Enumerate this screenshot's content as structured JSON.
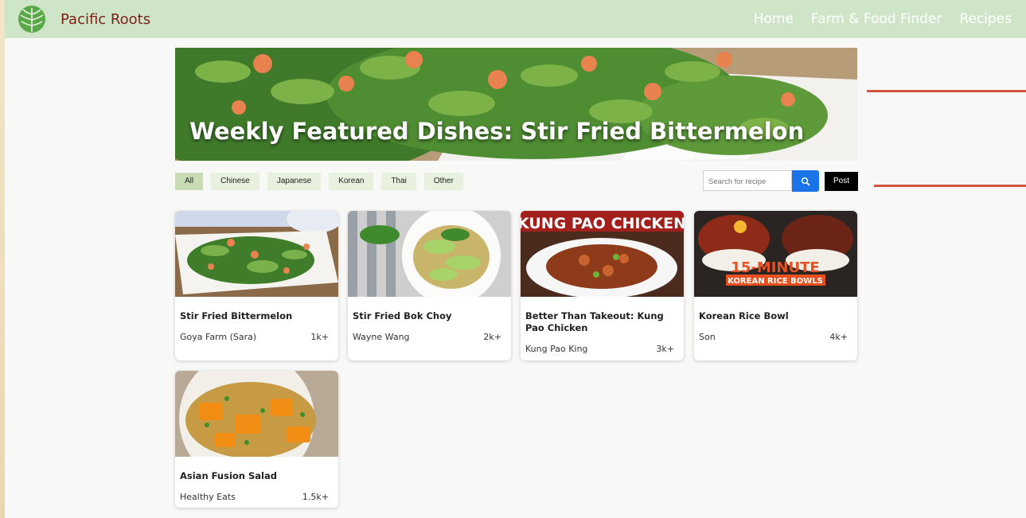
{
  "header": {
    "brand": "Pacific Roots",
    "nav": [
      "Home",
      "Farm & Food Finder",
      "Recipes"
    ]
  },
  "hero": {
    "title": "Weekly Featured Dishes: Stir Fried Bittermelon"
  },
  "filters": {
    "items": [
      "All",
      "Chinese",
      "Japanese",
      "Korean",
      "Thai",
      "Other"
    ],
    "active": "All"
  },
  "search": {
    "placeholder": "Search for recipe"
  },
  "post_label": "Post",
  "recipes": [
    {
      "title": "Stir Fried Bittermelon",
      "author": "Goya Farm (Sara)",
      "count": "1k+"
    },
    {
      "title": "Stir Fried Bok Choy",
      "author": "Wayne Wang",
      "count": "2k+"
    },
    {
      "title": "Better Than Takeout: Kung Pao Chicken",
      "author": "Kung Pao King",
      "count": "3k+",
      "image_text": "KUNG PAO CHICKEN"
    },
    {
      "title": "Korean Rice Bowl",
      "author": "Son",
      "count": "4k+",
      "image_text": [
        "15-MINUTE",
        "KOREAN RICE BOWLS"
      ]
    },
    {
      "title": "Asian Fusion Salad",
      "author": "Healthy Eats",
      "count": "1.5k+"
    }
  ],
  "colors": {
    "header_bg": "#cfe5c8",
    "brand": "#7c1f17",
    "search_button": "#1a73e8",
    "annotation": "#d1553e"
  }
}
